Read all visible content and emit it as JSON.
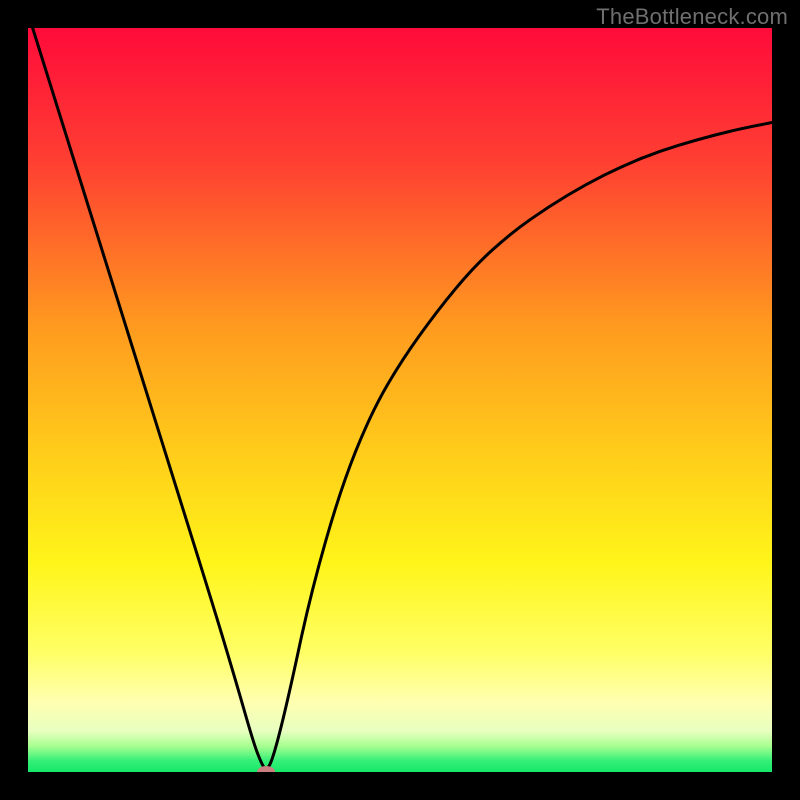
{
  "watermark": "TheBottleneck.com",
  "chart_data": {
    "type": "line",
    "title": "",
    "xlabel": "",
    "ylabel": "",
    "xlim": [
      0,
      100
    ],
    "ylim": [
      0,
      100
    ],
    "grid": false,
    "series": [
      {
        "name": "curve",
        "x": [
          0,
          5,
          10,
          15,
          20,
          25,
          28,
          30,
          31,
          32,
          33,
          35,
          38,
          42,
          46,
          50,
          55,
          60,
          65,
          70,
          75,
          80,
          85,
          90,
          95,
          100
        ],
        "values": [
          102,
          86,
          70,
          54,
          38,
          22,
          12,
          5,
          2,
          0,
          2,
          10,
          24,
          38,
          48,
          55,
          62,
          68,
          72.5,
          76,
          79,
          81.5,
          83.5,
          85,
          86.3,
          87.3
        ]
      }
    ],
    "marker": {
      "x": 32,
      "y": 0,
      "color": "#c98080",
      "rx": 9,
      "ry": 6
    },
    "gradient_stops": [
      {
        "offset": 0,
        "color": "#ff0b3a"
      },
      {
        "offset": 0.18,
        "color": "#ff3f32"
      },
      {
        "offset": 0.4,
        "color": "#ff9a1f"
      },
      {
        "offset": 0.58,
        "color": "#ffcf1a"
      },
      {
        "offset": 0.72,
        "color": "#fff51a"
      },
      {
        "offset": 0.84,
        "color": "#ffff66"
      },
      {
        "offset": 0.905,
        "color": "#ffffb0"
      },
      {
        "offset": 0.945,
        "color": "#e8ffc0"
      },
      {
        "offset": 0.965,
        "color": "#a8ff90"
      },
      {
        "offset": 0.985,
        "color": "#34ef78"
      },
      {
        "offset": 1.0,
        "color": "#15e868"
      }
    ]
  }
}
